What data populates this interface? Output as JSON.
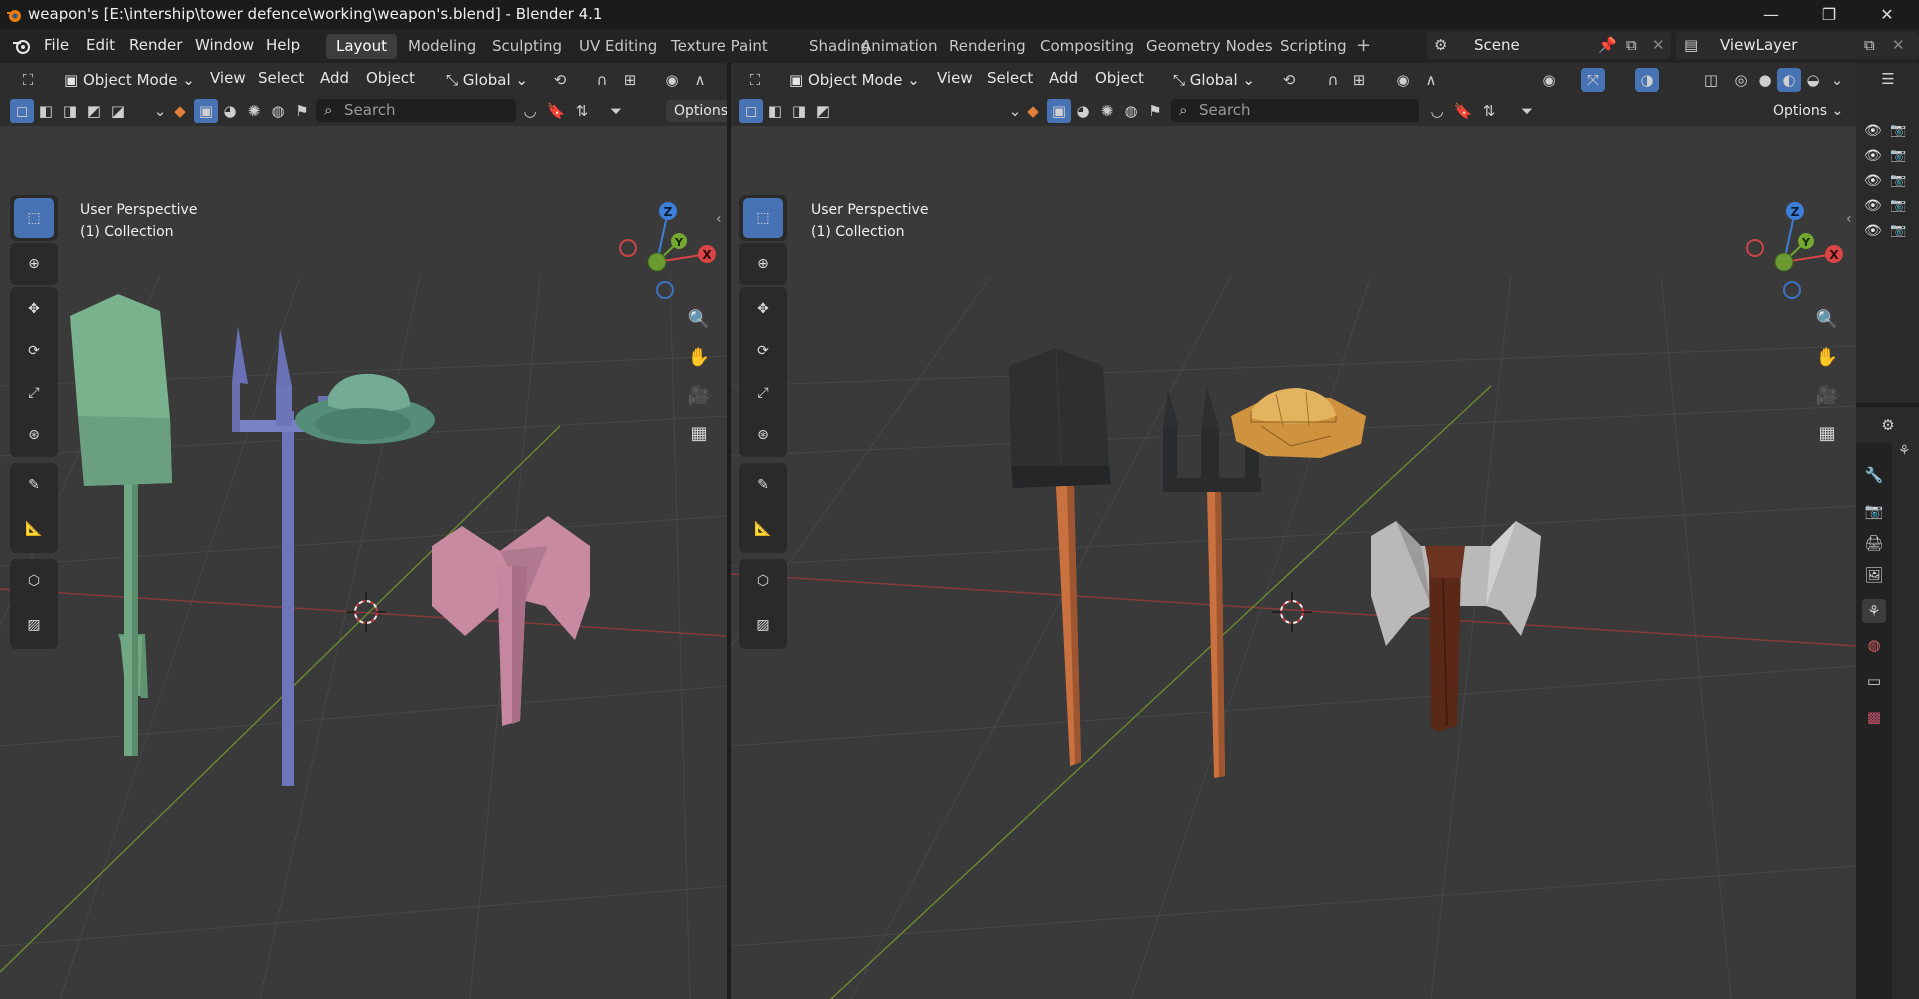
{
  "titlebar": {
    "title": "weapon's [E:\\intership\\tower defence\\working\\weapon's.blend] - Blender 4.1",
    "minimize": "—",
    "maximize": "❐",
    "close": "✕"
  },
  "menus": [
    "File",
    "Edit",
    "Render",
    "Window",
    "Help"
  ],
  "workspaces": [
    "Layout",
    "Modeling",
    "Sculpting",
    "UV Editing",
    "Texture Paint",
    "Shading",
    "Animation",
    "Rendering",
    "Compositing",
    "Geometry Nodes",
    "Scripting"
  ],
  "active_workspace": "Layout",
  "scene": "Scene",
  "view_layer": "ViewLayer",
  "viewport_left": {
    "mode": "Object Mode",
    "menus": [
      "View",
      "Select",
      "Add",
      "Object"
    ],
    "orientation": "Global",
    "search_placeholder": "Search",
    "options": "Options",
    "perspective": "User Perspective",
    "collection": "(1) Collection",
    "shading": "solid-object-color"
  },
  "viewport_right": {
    "mode": "Object Mode",
    "menus": [
      "View",
      "Select",
      "Add",
      "Object"
    ],
    "orientation": "Global",
    "search_placeholder": "Search",
    "options": "Options",
    "perspective": "User Perspective",
    "collection": "(1) Collection",
    "shading": "material-preview"
  },
  "gizmo_labels": {
    "z": "Z",
    "y": "Y",
    "x": "X"
  },
  "colors": {
    "accent": "#4772b3",
    "shovel_left": "#6fa882",
    "pitchfork_left": "#6e74b8",
    "hat_left": "#6aa38f",
    "axe_left": "#c4879f",
    "wood": "#c9713f",
    "dark_metal": "#2e2f31",
    "straw": "#d8a24f",
    "axe_blade": "#b7b7b7",
    "axe_handle": "#5a2816"
  },
  "icons": [
    "blender-logo-icon",
    "scene-icon",
    "view-layer-icon",
    "select-box-icon",
    "cursor-icon",
    "move-icon",
    "rotate-icon",
    "scale-icon",
    "transform-icon",
    "annotate-icon",
    "measure-icon",
    "add-cube-icon",
    "zoom-icon",
    "hand-icon",
    "camera-icon",
    "grid-icon",
    "eye-icon",
    "camera-render-icon",
    "tool-icon",
    "render-icon",
    "output-icon",
    "view-layer-props-icon",
    "scene-props-icon",
    "world-icon",
    "collection-props-icon",
    "texture-icon"
  ]
}
